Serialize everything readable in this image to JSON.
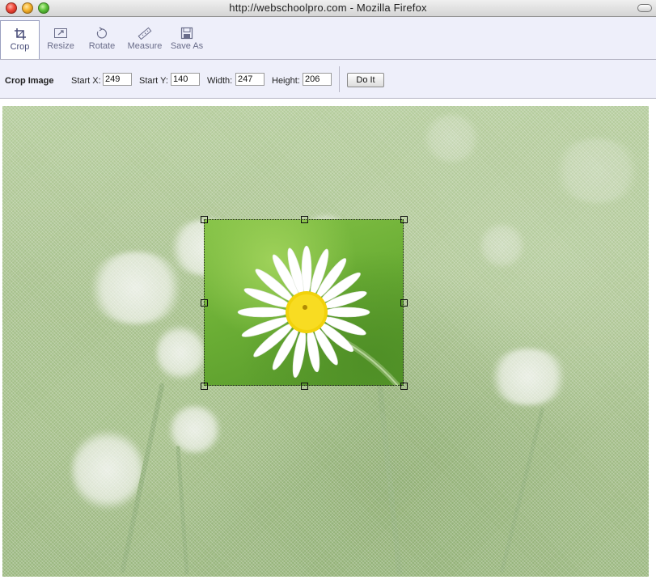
{
  "window": {
    "title": "http://webschoolpro.com - Mozilla Firefox"
  },
  "toolbar": {
    "tools": [
      {
        "label": "Crop",
        "icon": "crop-icon",
        "active": true
      },
      {
        "label": "Resize",
        "icon": "resize-icon",
        "active": false
      },
      {
        "label": "Rotate",
        "icon": "rotate-icon",
        "active": false
      },
      {
        "label": "Measure",
        "icon": "ruler-icon",
        "active": false
      },
      {
        "label": "Save As",
        "icon": "floppy-disk-icon",
        "active": false
      }
    ]
  },
  "crop_options": {
    "title": "Crop Image",
    "start_x_label": "Start X:",
    "start_x": "249",
    "start_y_label": "Start Y:",
    "start_y": "140",
    "width_label": "Width:",
    "width": "247",
    "height_label": "Height:",
    "height": "206",
    "do_it_label": "Do It"
  },
  "colors": {
    "toolbar_bg": "#eeeffa",
    "tool_label": "#6a6d8a"
  }
}
